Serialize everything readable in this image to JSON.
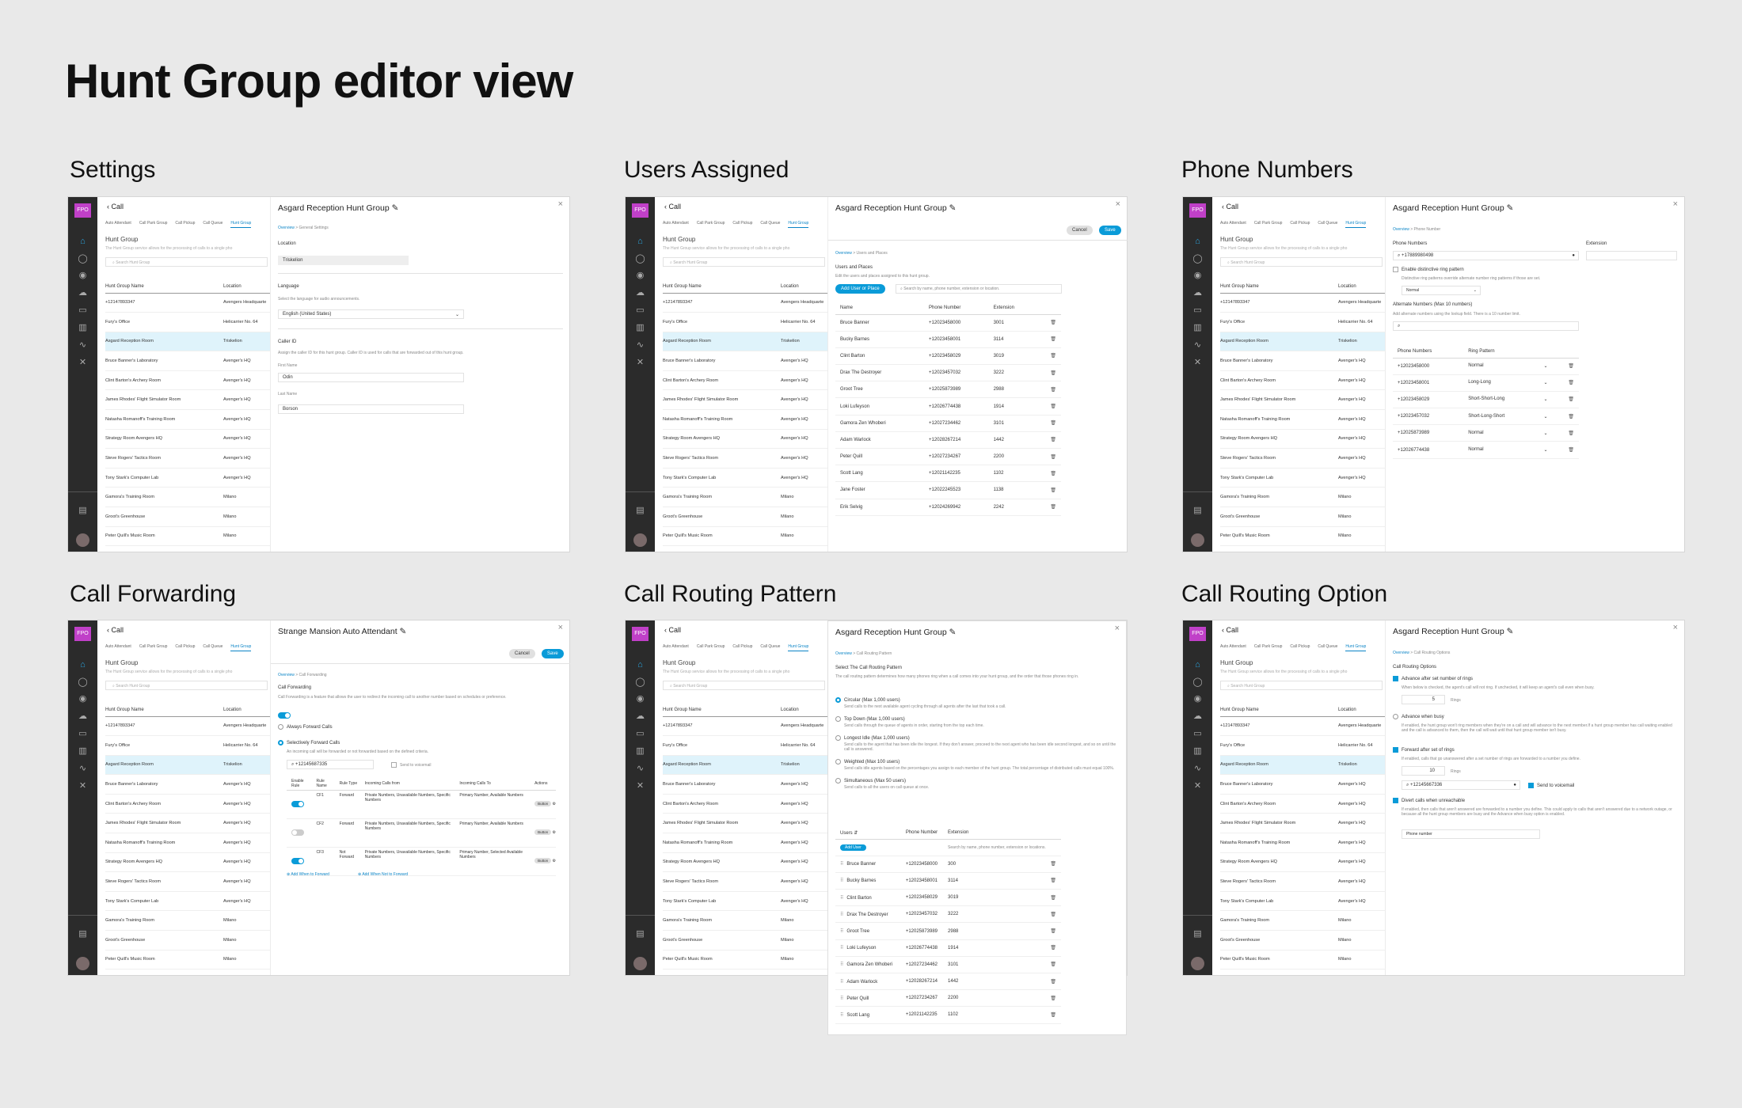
{
  "page": {
    "title": "Hunt Group editor view"
  },
  "sections": {
    "settings": "Settings",
    "users": "Users Assigned",
    "phones": "Phone Numbers",
    "forwarding": "Call Forwarding",
    "routing_pattern": "Call Routing Pattern",
    "routing_option": "Call Routing Option"
  },
  "shared": {
    "rail": {
      "badge": "FPO"
    },
    "back": "Call",
    "tabs": [
      "Auto Attendant",
      "Call Park Group",
      "Call Pickup",
      "Call Queue",
      "Hunt Group"
    ],
    "left_title": "Hunt Group",
    "left_desc": "The Hunt Group service allows for the processing of calls to a single pho",
    "search_placeholder": "Search Hunt Group",
    "col_name": "Hunt Group Name",
    "col_location": "Location",
    "rows": [
      [
        "+12147893347",
        "Avengers Headquarte"
      ],
      [
        "Fury's Office",
        "Helicarrier No. 64"
      ],
      [
        "Asgard Reception Room",
        "Triskelion"
      ],
      [
        "Bruce Banner's Laboratory",
        "Avenger's HQ"
      ],
      [
        "Clint Barton's Archery Room",
        "Avenger's HQ"
      ],
      [
        "James Rhodes' Flight Simulator Room",
        "Avenger's HQ"
      ],
      [
        "Natasha Romanoff's Training Room",
        "Avenger's HQ"
      ],
      [
        "Strategy Room Avengers HQ",
        "Avenger's HQ"
      ],
      [
        "Steve Rogers' Tactics Room",
        "Avenger's HQ"
      ],
      [
        "Tony Stark's Computer Lab",
        "Avenger's HQ"
      ],
      [
        "Gamora's Training Room",
        "Milano"
      ],
      [
        "Groot's Greenhouse",
        "Milano"
      ],
      [
        "Peter Quill's Music Room",
        "Milano"
      ]
    ],
    "panel_title": "Asgard Reception Hunt Group",
    "overview": "Overview",
    "cancel": "Cancel",
    "save": "Save"
  },
  "p1": {
    "crumb": "General Settings",
    "location_label": "Location",
    "location_value": "Triskelion",
    "language_label": "Language",
    "language_desc": "Select the language for audio announcements.",
    "language_value": "English (United States)",
    "callerid_label": "Caller ID",
    "callerid_desc": "Assign the caller ID for this hunt group. Caller ID is used for calls that are forwarded out of this hunt group.",
    "first_label": "First Name",
    "first_value": "Odin",
    "last_label": "Last Name",
    "last_value": "Borson"
  },
  "p2": {
    "crumb": "Users and Places",
    "heading": "Users and Places",
    "desc": "Edit the users and places assigned to this hunt group.",
    "add": "Add User or Place",
    "search": "Search by name, phone number, extension or location.",
    "cols": [
      "Name",
      "Phone Number",
      "Extension"
    ],
    "rows": [
      [
        "Bruce Banner",
        "+12023458000",
        "3001"
      ],
      [
        "Bucky Barnes",
        "+12023458001",
        "3114"
      ],
      [
        "Clint Barton",
        "+12023458029",
        "3019"
      ],
      [
        "Drax The Destroyer",
        "+12023457032",
        "3222"
      ],
      [
        "Groot Tree",
        "+12025873989",
        "2988"
      ],
      [
        "Loki Lufeyson",
        "+12026774438",
        "1914"
      ],
      [
        "Gamora Zen Whoberi",
        "+12027234462",
        "3101"
      ],
      [
        "Adam Warlock",
        "+12028267214",
        "1442"
      ],
      [
        "Peter Quill",
        "+12027234267",
        "2200"
      ],
      [
        "Scott Lang",
        "+12021142235",
        "1102"
      ],
      [
        "Jane Foster",
        "+12022245523",
        "1138"
      ],
      [
        "Erik Selvig",
        "+12024269942",
        "2242"
      ]
    ]
  },
  "p3": {
    "crumb": "Phone Number",
    "phone_label": "Phone Numbers",
    "phone_value": "+17889980498",
    "ext_label": "Extension",
    "distinctive": "Enable distinctive ring pattern",
    "distinctive_desc": "Distinctive ring patterns override alternate number ring patterns if those are set.",
    "pattern_default": "Normal",
    "alt_label": "Alternate Numbers (Max 10 numbers)",
    "alt_desc": "Add alternate numbers using the lookup field. There is a 10 number limit.",
    "cols": [
      "Phone Numbers",
      "Ring Pattern"
    ],
    "rows": [
      [
        "+12023458000",
        "Normal"
      ],
      [
        "+12023458001",
        "Long-Long"
      ],
      [
        "+12023458029",
        "Short-Short-Long"
      ],
      [
        "+12023457032",
        "Short-Long-Short"
      ],
      [
        "+12025873989",
        "Normal"
      ],
      [
        "+12026774438",
        "Normal"
      ]
    ]
  },
  "p4": {
    "panel_title": "Strange Mansion Auto Attendant",
    "crumb": "Call Forwarding",
    "heading": "Call Forwarding",
    "desc": "Call Forwarding is a feature that allows the user to redirect the incoming call to another number based on schedules or preference.",
    "always": "Always Forward Calls",
    "selective": "Selectively Forward Calls",
    "selective_desc": "An incoming call will be forwarded or not forwarded based on the defined criteria.",
    "number": "+12145687335",
    "voicemail": "Send to voicemail",
    "cols": [
      "Enable Rule",
      "Rule Name",
      "Rule Type",
      "Incoming Calls from",
      "Incoming Calls To",
      "Actions"
    ],
    "rows": [
      [
        "CF1",
        "Forward",
        "Private Numbers, Unavailable Numbers, Specific Numbers",
        "Primary Number, Available Numbers"
      ],
      [
        "CF2",
        "Forward",
        "Private Numbers, Unavailable Numbers, Specific Numbers",
        "Primary Number, Available Numbers"
      ],
      [
        "CF3",
        "Not Forward",
        "Private Numbers, Unavailable Numbers, Specific Numbers",
        "Primary Number, Selected Available Numbers"
      ]
    ],
    "button": "Button",
    "add_forward": "Add When to Forward",
    "add_not": "Add When Not to Forward"
  },
  "p5": {
    "crumb": "Call Routing Pattern",
    "heading": "Select The Call Routing Pattern",
    "desc": "The call routing pattern determines how many phones ring when a call comes into your hunt group, and the order that those phones ring in.",
    "options": [
      [
        "Circular (Max 1,000 users)",
        "Send calls to the next available agent cycling through all agents after the last that took a call."
      ],
      [
        "Top Down (Max 1,000 users)",
        "Send calls through the queue of agents in order, starting from the top each time."
      ],
      [
        "Longest Idle (Max 1,000 users)",
        "Send calls to the agent that has been idle the longest. If they don't answer, proceed to the next agent who has been idle second longest, and so on until the call is answered."
      ],
      [
        "Weighted (Max 100 users)",
        "Send calls idle agents based on the percentages you assign to each member of the hunt group. The total percentage of distributed calls must equal 100%."
      ],
      [
        "Simultaneous (Max 50 users)",
        "Send calls to all the users on call queue at once."
      ]
    ],
    "cols": [
      "Users",
      "Phone Number",
      "Extension"
    ],
    "add": "Add User",
    "search": "Search by name, phone number, extension or locations.",
    "rows": [
      [
        "Bruce Banner",
        "+12023458000",
        "300"
      ],
      [
        "Bucky Barnes",
        "+12023458001",
        "3114"
      ],
      [
        "Clint Barton",
        "+12023458029",
        "3019"
      ],
      [
        "Drax The Destroyer",
        "+12023457032",
        "3222"
      ],
      [
        "Groot Tree",
        "+12025873989",
        "2988"
      ],
      [
        "Loki Lufeyson",
        "+12026774438",
        "1914"
      ],
      [
        "Gamora Zen Whoberi",
        "+12027234462",
        "3101"
      ],
      [
        "Adam Warlock",
        "+12028267214",
        "1442"
      ],
      [
        "Peter Quill",
        "+12027234267",
        "2200"
      ],
      [
        "Scott Lang",
        "+12021142235",
        "1102"
      ]
    ]
  },
  "p6": {
    "crumb": "Call Routing Options",
    "heading": "Call Routing Options",
    "advance": "Advance after set number of rings",
    "advance_desc": "When below is checked, the agent's call will not ring. If unchecked, it will keep an agent's call even when busy.",
    "rings1": "5",
    "rings_label": "Rings",
    "busy": "Advance when busy",
    "busy_desc": "If enabled, the hunt group won't ring members when they're on a call and will advance to the next member.If a hunt group member has call waiting enabled and the call is advanced to them, then the call will wait until that hunt group member isn't busy.",
    "forward": "Forward after set of rings",
    "forward_desc": "If enabled, calls that go unanswered after a set number of rings are forwarded to a number you define.",
    "rings2": "10",
    "fwd_number": "+12145667336",
    "voicemail": "Send to voicemail",
    "divert": "Divert calls when unreachable",
    "divert_desc": "If enabled, then calls that aren't answered are forwarded to a number you define. This could apply to calls that aren't answered due to a network outage, or because all the hunt group members are busy and the Advance when busy option is enabled.",
    "phone_placeholder": "Phone number"
  }
}
